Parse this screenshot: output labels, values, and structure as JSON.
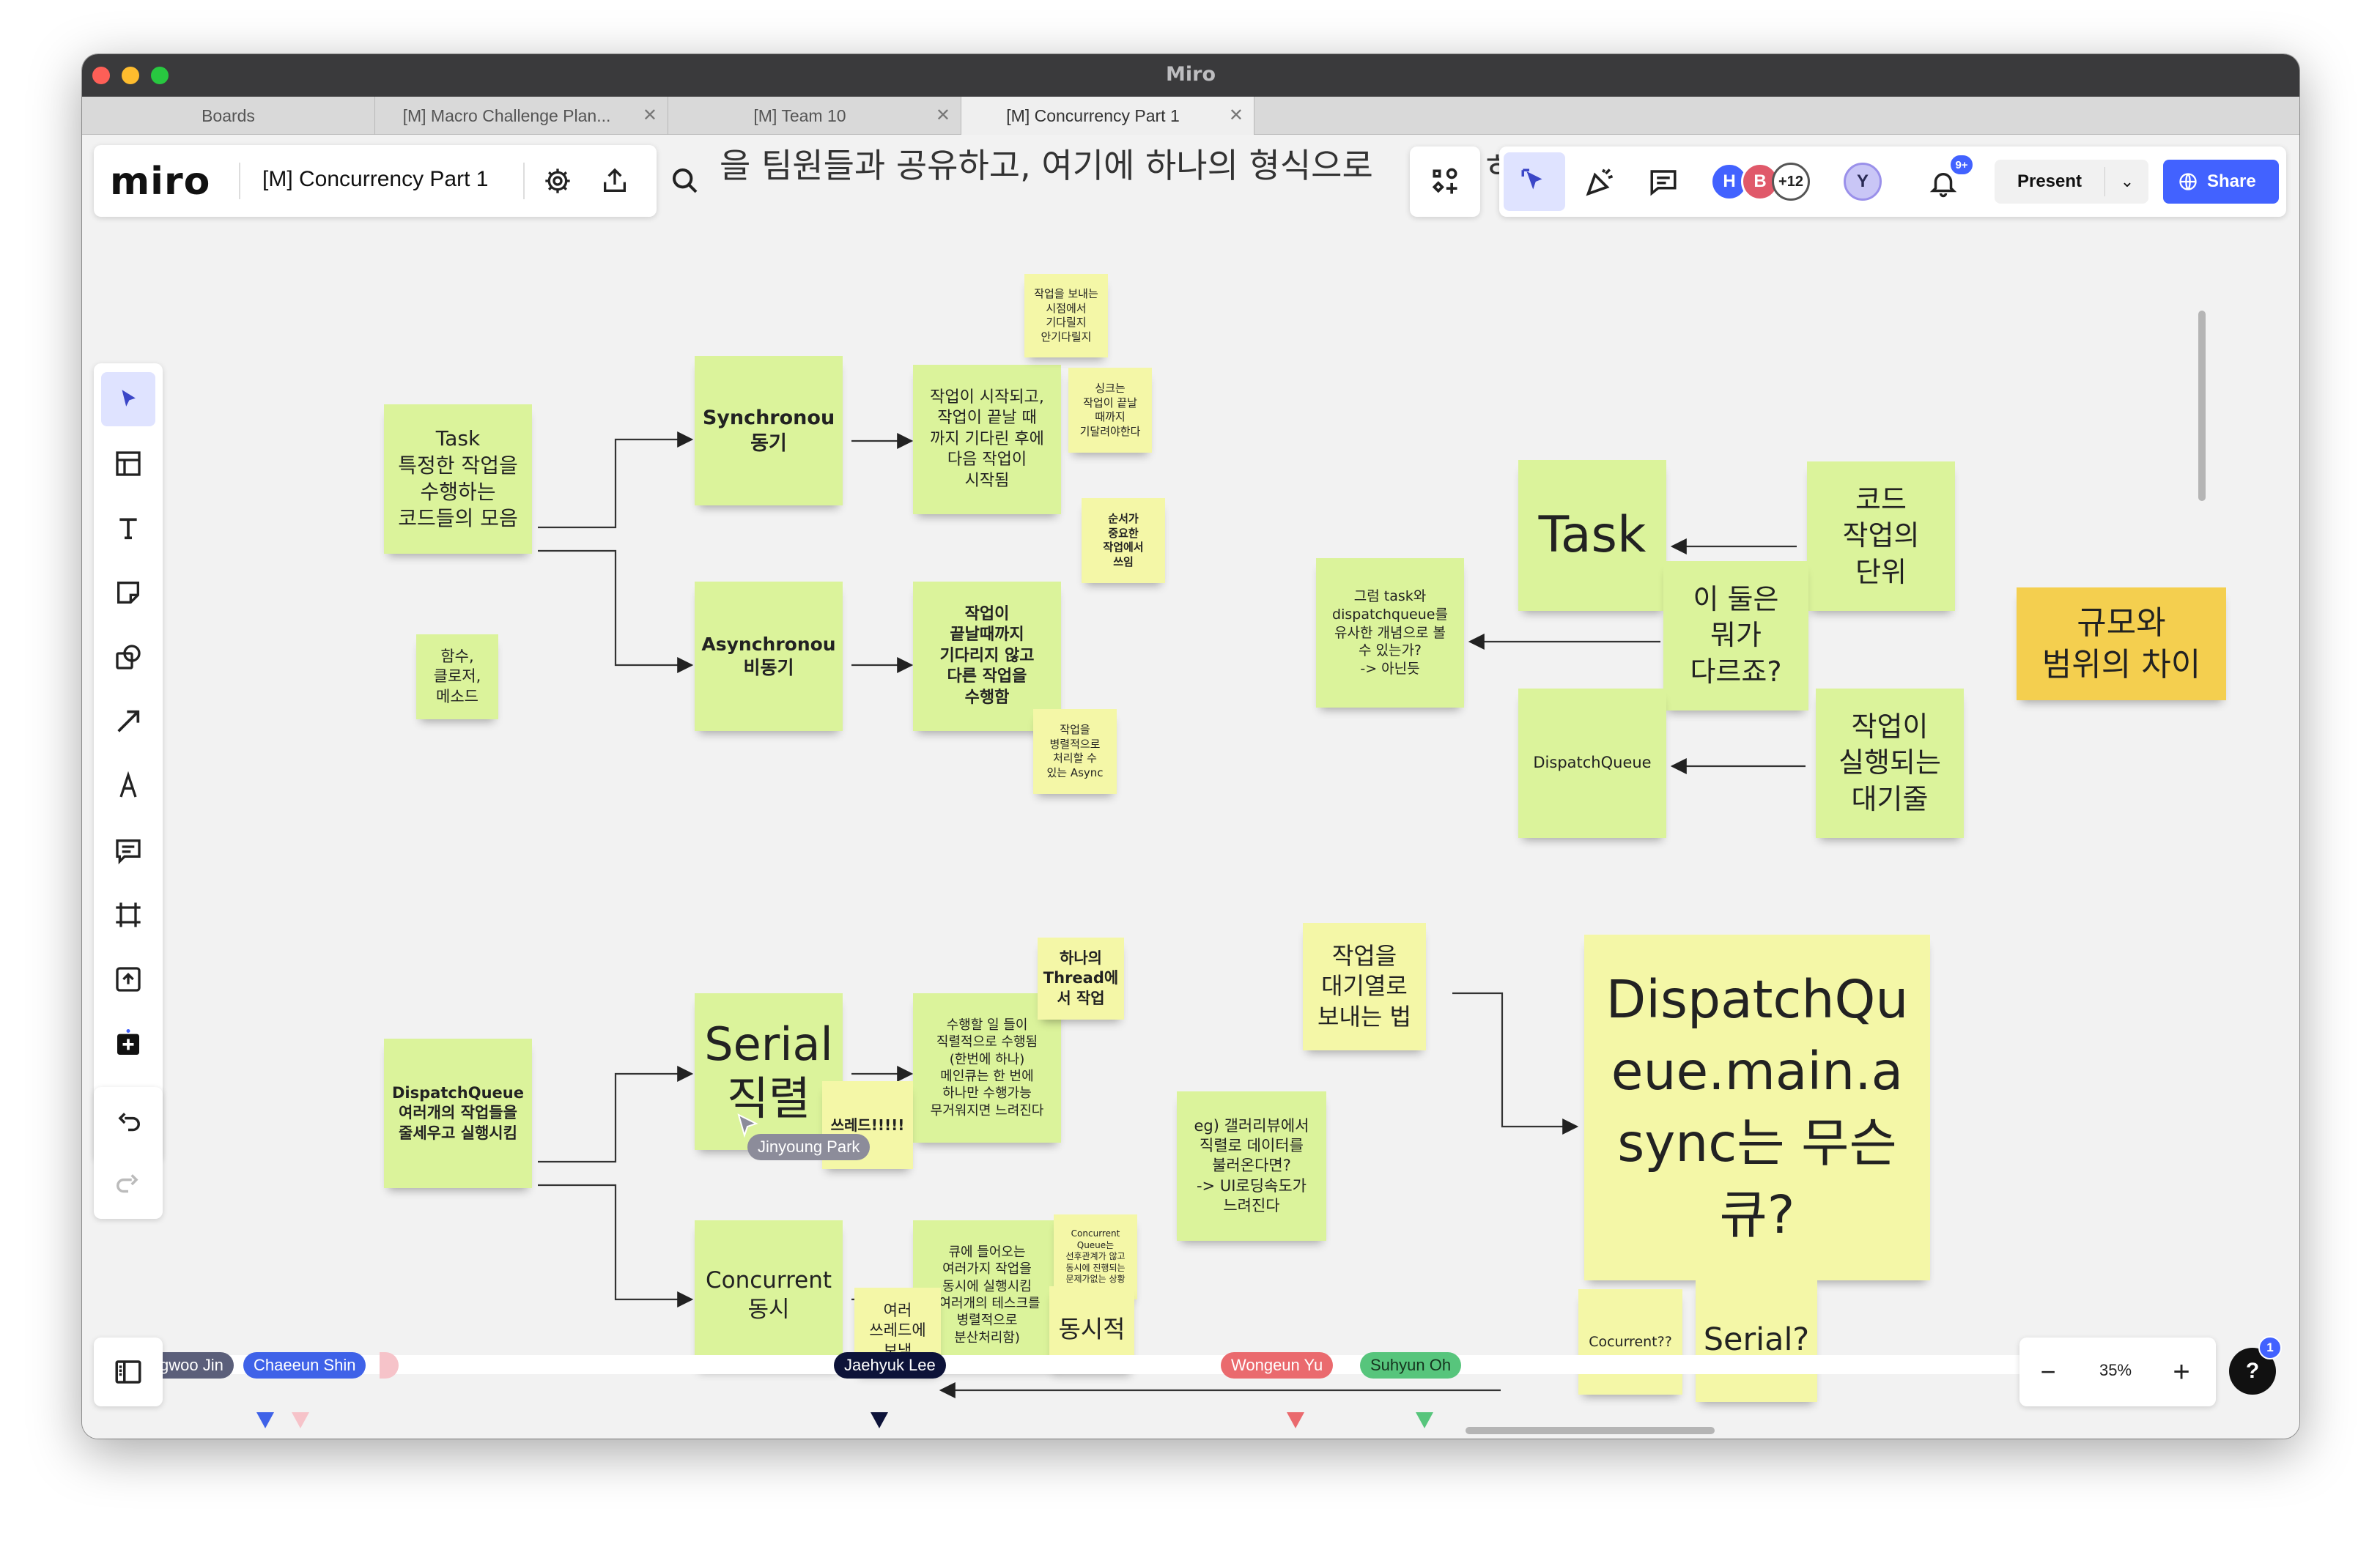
{
  "window": {
    "title": "Miro"
  },
  "tabs": [
    {
      "label": "Boards"
    },
    {
      "label": "[M] Macro Challenge Plan..."
    },
    {
      "label": "[M] Team 10"
    },
    {
      "label": "[M] Concurrency Part 1"
    }
  ],
  "toolbar": {
    "logo": "miro",
    "board_name": "[M] Concurrency Part 1",
    "present_label": "Present",
    "share_label": "Share",
    "overflow_count": "+12",
    "notification_badge": "9+",
    "avatars": [
      {
        "initial": "H",
        "color": "#4262ff"
      },
      {
        "initial": "B",
        "color": "#e0596a"
      },
      {
        "initial": "Y",
        "color": "#c9c6f6"
      }
    ]
  },
  "canvas_header_text": "을 팀원들과 공유하고, 여기에 하나의 형식으로",
  "notes": {
    "task_def": "Task\n특정한 작업을\n수행하는\n코드들의 모음",
    "funcs": "함수,\n클로저,\n메소드",
    "sync": "Synchronou\n동기",
    "async": "Asynchronou\n비동기",
    "sync_desc": "작업이 시작되고,\n작업이 끝날 때\n까지 기다린 후에\n다음 작업이\n시작됨",
    "async_desc": "작업이\n끝날때까지\n기다리지 않고\n다른 작업을\n수행함",
    "small_wait": "작업을 보내는\n시점에서\n기다릴지\n안기다릴지",
    "small_sync": "싱크는\n작업이 끝날\n때까지\n기달려야한다",
    "small_order": "순서가\n중요한\n작업에서\n쓰임",
    "small_async": "작업을\n병렬적으로\n처리할 수\n있는 Async",
    "task_big": "Task",
    "code_unit": "코드\n작업의\n단위",
    "diff_q": "이 둘은\n뭐가\n다르죠?",
    "similar_q": "그럼 task와\ndispatchqueue를\n유사한 개념으로 볼\n수 있는가?\n-> 아닌듯",
    "dq_label": "DispatchQueue",
    "exec_queue": "작업이\n실행되는\n대기줄",
    "scale_diff": "규모와\n범위의 차이",
    "dq_def": "DispatchQueue\n여러개의 작업들을\n줄세우고 실행시킴",
    "serial": "Serial\n직렬",
    "concurrent": "Concurrent\n동시",
    "one_thread": "하나의\nThread에\n서 작업",
    "serial_desc": "수행할 일 들이\n직렬적으로 수행됨\n(한번에 하나)\n메인큐는 한 번에\n하나만 수행가능\n무거워지면 느려진다",
    "threads": "쓰레드!!!!!",
    "conc_desc": "큐에 들어오는\n여러가지 작업을\n동시에 실행시킴\n(여러개의 테스크를\n병렬적으로\n분산처리함)",
    "conc_small": "Concurrent\nQueue는\n선후관계가 않고\n동시에 진행되는\n문제가없는 상황",
    "multi_threads": "여러\n쓰레드에\n보냄",
    "simultaneous": "동시적",
    "send_queue": "작업을\n대기열로\n보내는 법",
    "gallery": "eg) 갤러리뷰에서\n직렬로 데이터를\n불러온다면?\n-> UI로딩속도가\n느려진다",
    "main_async": "DispatchQu\neue.main.a\nsync는 무슨\n큐?",
    "concurrent_q": "Cocurrent??",
    "serial_q": "Serial?"
  },
  "cursors": [
    {
      "name": "Jinyoung Park",
      "color": "#8c8c9a"
    },
    {
      "name": "gwoo Jin",
      "color": "#5b5f7a"
    },
    {
      "name": "Chaeeun Shin",
      "color": "#3f62e8"
    },
    {
      "name": "Jaehyuk Lee",
      "color": "#0d1339"
    },
    {
      "name": "Wongeun Yu",
      "color": "#ea6a6e"
    },
    {
      "name": "Suhyun Oh",
      "color": "#57c57c"
    }
  ],
  "zoom": {
    "level": "35%",
    "help_badge": "1"
  },
  "icons": {
    "tools": [
      "select-icon",
      "templates-icon",
      "text-icon",
      "sticky-note-icon",
      "shapes-icon",
      "pen-arrow-icon",
      "pen-icon",
      "comment-icon",
      "frame-icon",
      "upload-icon",
      "more-tools-icon",
      "undo-icon",
      "redo-icon"
    ]
  }
}
